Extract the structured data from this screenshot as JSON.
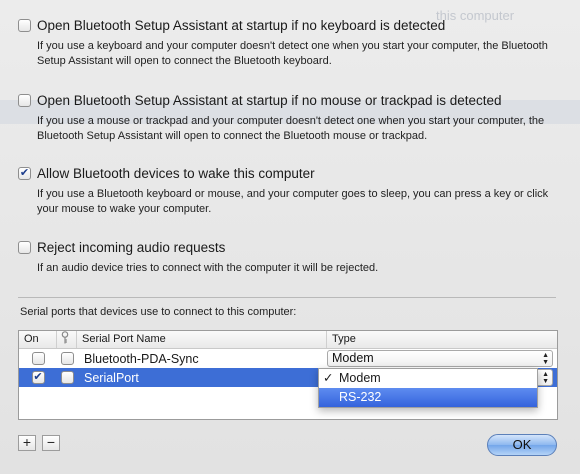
{
  "background_ghost": "this computer",
  "options": [
    {
      "label": "Open Bluetooth Setup Assistant at startup if no keyboard is detected",
      "description": "If you use a keyboard and your computer doesn't detect one when you start your computer, the Bluetooth Setup Assistant will open to connect the Bluetooth keyboard.",
      "checked": false
    },
    {
      "label": "Open Bluetooth Setup Assistant at startup if no mouse or trackpad is detected",
      "description": "If you use a mouse or trackpad and your computer doesn't detect one when you start your computer, the Bluetooth Setup Assistant will open to connect the Bluetooth mouse or trackpad.",
      "checked": false
    },
    {
      "label": "Allow Bluetooth devices to wake this computer",
      "description": "If you use a Bluetooth keyboard or mouse, and your computer goes to sleep, you can press a key or click your mouse to wake your computer.",
      "checked": true
    },
    {
      "label": "Reject incoming audio requests",
      "description": "If an audio device tries to connect with the computer it will be rejected.",
      "checked": false
    }
  ],
  "ports": {
    "caption": "Serial ports that devices use to connect to this computer:",
    "headers": {
      "on": "On",
      "key": "",
      "name": "Serial Port Name",
      "type": "Type"
    },
    "rows": [
      {
        "on": false,
        "secure": false,
        "name": "Bluetooth-PDA-Sync",
        "type": "Modem",
        "selected": false
      },
      {
        "on": true,
        "secure": false,
        "name": "SerialPort",
        "type": "Modem",
        "selected": true
      }
    ],
    "type_menu": [
      {
        "label": "Modem",
        "checked": true,
        "highlighted": false
      },
      {
        "label": "RS-232",
        "checked": false,
        "highlighted": true
      }
    ]
  },
  "buttons": {
    "add": "+",
    "remove": "−",
    "ok": "OK"
  },
  "colors": {
    "selection": "#3d6ed6",
    "ok_button": "#8db8ef"
  }
}
